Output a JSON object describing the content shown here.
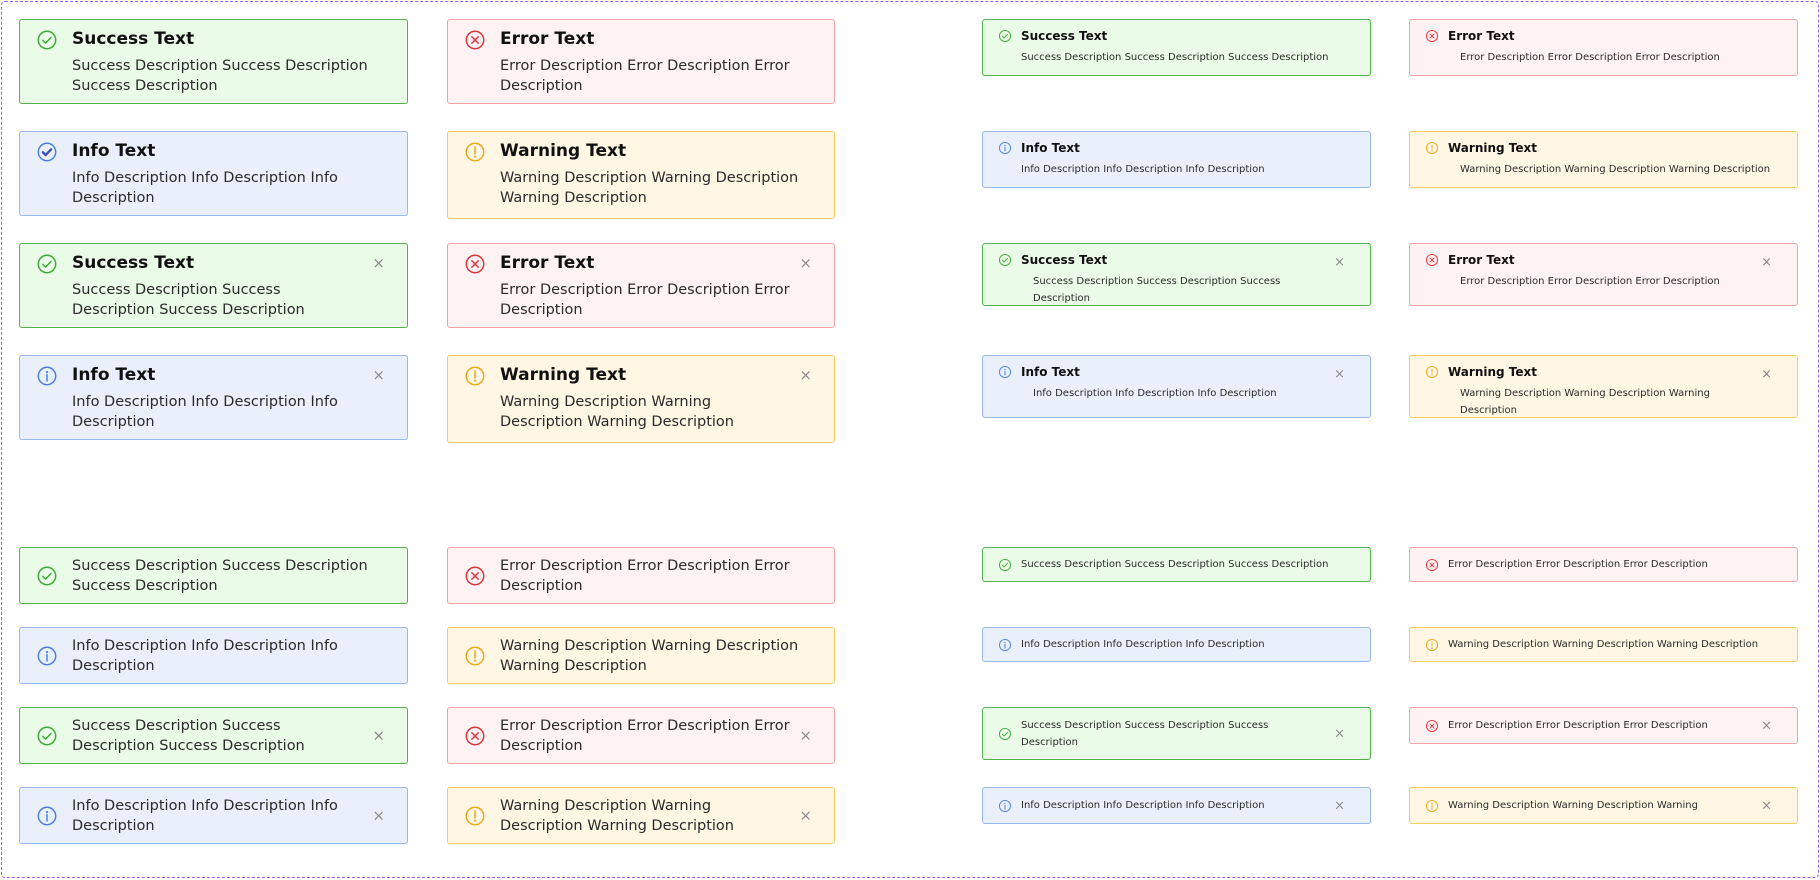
{
  "colors": {
    "success": "#3bab35",
    "error": "#e0333a",
    "info": "#4d7fd8",
    "info_check": "#3a4fb8",
    "warning": "#e8a913",
    "close": "#8a8a8a",
    "frame": "#9b5cf6"
  },
  "close_glyph": "×",
  "alerts_large": [
    {
      "type": "success",
      "icon": "check-circle-icon",
      "title": "Success Text",
      "desc": "Success Description Success Description Success Description",
      "closable": false
    },
    {
      "type": "error",
      "icon": "x-circle-icon",
      "title": "Error Text",
      "desc": "Error Description Error Description Error Description",
      "closable": false
    },
    {
      "type": "info",
      "icon": "check-filled-circle-icon",
      "title": "Info Text",
      "desc": "Info Description Info Description Info Description",
      "closable": false
    },
    {
      "type": "warning",
      "icon": "exclamation-circle-icon",
      "title": "Warning Text",
      "desc": "Warning Description Warning Description Warning Description",
      "closable": false
    },
    {
      "type": "success",
      "icon": "check-circle-icon",
      "title": "Success Text",
      "desc": "Success Description Success Description Success Description",
      "closable": true
    },
    {
      "type": "error",
      "icon": "x-circle-icon",
      "title": "Error Text",
      "desc": "Error Description Error Description Error Description",
      "closable": true
    },
    {
      "type": "info",
      "icon": "info-circle-icon",
      "title": "Info Text",
      "desc": "Info Description Info Description Info Description",
      "closable": true
    },
    {
      "type": "warning",
      "icon": "exclamation-circle-icon",
      "title": "Warning Text",
      "desc": "Warning Description Warning Description Warning Description",
      "closable": true
    }
  ],
  "alerts_small": [
    {
      "type": "success",
      "icon": "check-circle-icon",
      "title": "Success Text",
      "desc": "Success Description Success Description Success Description",
      "closable": false
    },
    {
      "type": "error",
      "icon": "x-circle-icon",
      "title": "Error Text",
      "desc": "Error Description Error Description Error Description",
      "closable": false
    },
    {
      "type": "info",
      "icon": "info-circle-icon",
      "title": "Info Text",
      "desc": "Info Description Info Description Info Description",
      "closable": false
    },
    {
      "type": "warning",
      "icon": "exclamation-circle-icon",
      "title": "Warning Text",
      "desc": "Warning Description Warning Description Warning Description",
      "closable": false
    },
    {
      "type": "success",
      "icon": "check-circle-icon",
      "title": "Success Text",
      "desc": "Success Description Success Description Success Description",
      "closable": true
    },
    {
      "type": "error",
      "icon": "x-circle-icon",
      "title": "Error Text",
      "desc": "Error Description Error Description Error Description",
      "closable": true
    },
    {
      "type": "info",
      "icon": "info-circle-icon",
      "title": "Info Text",
      "desc": "Info Description Info Description Info Description",
      "closable": true
    },
    {
      "type": "warning",
      "icon": "exclamation-circle-icon",
      "title": "Warning Text",
      "desc": "Warning Description Warning Description Warning Description",
      "closable": true
    }
  ],
  "desc_only_large": [
    {
      "type": "success",
      "icon": "check-circle-icon",
      "desc": "Success Description Success Description Success Description",
      "closable": false
    },
    {
      "type": "error",
      "icon": "x-circle-icon",
      "desc": "Error Description Error Description Error Description",
      "closable": false
    },
    {
      "type": "info",
      "icon": "info-circle-icon",
      "desc": "Info Description Info Description Info Description",
      "closable": false
    },
    {
      "type": "warning",
      "icon": "exclamation-circle-icon",
      "desc": "Warning Description Warning Description Warning Description",
      "closable": false
    },
    {
      "type": "success",
      "icon": "check-circle-icon",
      "desc": "Success Description Success Description Success Description",
      "closable": true
    },
    {
      "type": "error",
      "icon": "x-circle-icon",
      "desc": "Error Description Error Description Error Description",
      "closable": true
    },
    {
      "type": "info",
      "icon": "info-circle-icon",
      "desc": "Info Description Info Description Info Description",
      "closable": true
    },
    {
      "type": "warning",
      "icon": "exclamation-circle-icon",
      "desc": "Warning Description Warning Description Warning Description",
      "closable": true
    }
  ],
  "desc_only_small": [
    {
      "type": "success",
      "icon": "check-circle-icon",
      "desc": "Success Description Success Description Success Description",
      "closable": false
    },
    {
      "type": "error",
      "icon": "x-circle-icon",
      "desc": "Error Description Error Description Error Description",
      "closable": false
    },
    {
      "type": "info",
      "icon": "info-circle-icon",
      "desc": "Info Description Info Description Info Description",
      "closable": false
    },
    {
      "type": "warning",
      "icon": "exclamation-circle-icon",
      "desc": "Warning Description Warning Description Warning Description",
      "closable": false
    },
    {
      "type": "success",
      "icon": "check-circle-icon",
      "desc": "Success Description Success Description Success Description",
      "closable": true
    },
    {
      "type": "error",
      "icon": "x-circle-icon",
      "desc": "Error Description Error Description Error Description",
      "closable": true
    },
    {
      "type": "info",
      "icon": "info-circle-icon",
      "desc": "Info Description Info Description Info Description",
      "closable": true
    },
    {
      "type": "warning",
      "icon": "exclamation-circle-icon",
      "desc": "Warning Description Warning Description Warning",
      "closable": true
    }
  ]
}
